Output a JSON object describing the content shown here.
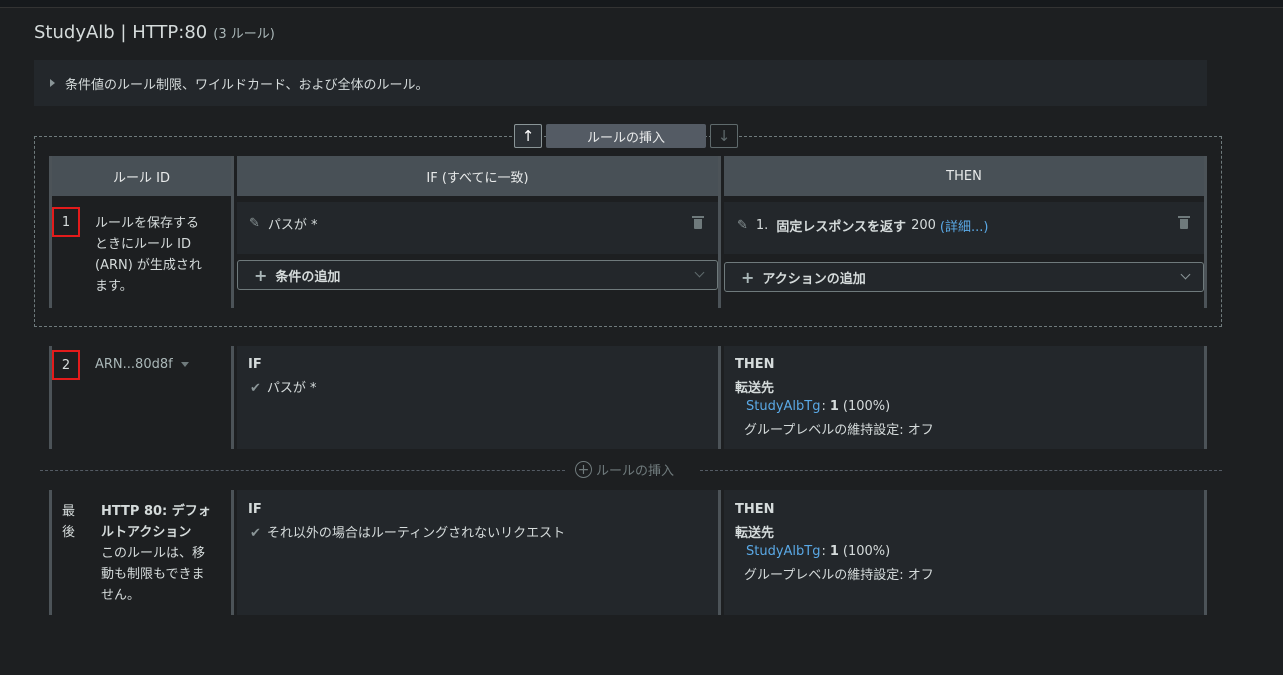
{
  "page": {
    "title": "StudyAlb | HTTP:80",
    "rule_count": "(3 ルール)",
    "info_text": "条件値のルール制限、ワイルドカード、および全体のルール。"
  },
  "insert_toolbar": {
    "up_arrow": "↑",
    "down_arrow": "↓",
    "insert_label": "ルールの挿入"
  },
  "columns": {
    "rule_id": "ルール ID",
    "if": "IF (すべてに一致)",
    "then": "THEN"
  },
  "rule1": {
    "number": "1",
    "desc_lines": [
      "ルールを保存する",
      "ときにルール ID",
      "(ARN) が生成され",
      "ます。"
    ],
    "condition": "パスが *",
    "add_condition": "条件の追加",
    "action_prefix": "1.",
    "action_bold": "固定レスポンスを返す",
    "action_code": "200",
    "action_link": "(詳細...)",
    "add_action": "アクションの追加"
  },
  "rule2": {
    "number": "2",
    "arn": "ARN...80d8f",
    "if_label": "IF",
    "condition": "パスが *",
    "then_label": "THEN",
    "forward_label": "転送先",
    "target_link": "StudyAlbTg",
    "target_sep": ":",
    "target_weight": "1",
    "target_pct": "(100%)",
    "stickiness": "グループレベルの維持設定: オフ"
  },
  "insert_between": {
    "label": "ルールの挿入"
  },
  "rule_last": {
    "number_lines": [
      "最",
      "後"
    ],
    "title_lines": [
      "HTTP 80: デフォ",
      "ルトアクション"
    ],
    "desc_lines": [
      "このルールは、移",
      "動も制限もできま",
      "せん。"
    ],
    "if_label": "IF",
    "condition": "それ以外の場合はルーティングされないリクエスト",
    "then_label": "THEN",
    "forward_label": "転送先",
    "target_link": "StudyAlbTg",
    "target_sep": ":",
    "target_weight": "1",
    "target_pct": "(100%)",
    "stickiness": "グループレベルの維持設定: オフ"
  }
}
